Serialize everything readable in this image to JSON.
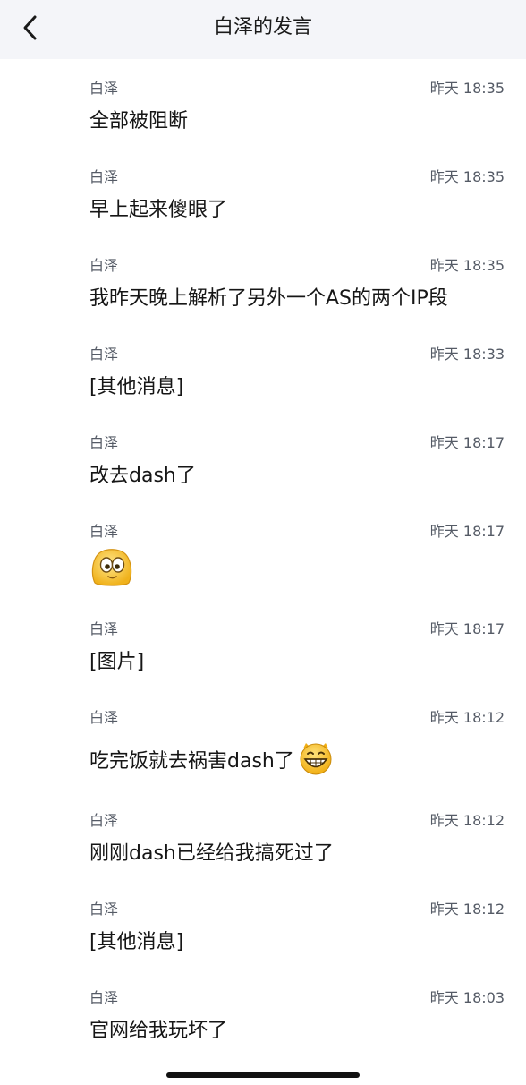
{
  "header": {
    "title": "白泽的发言",
    "back_icon": "chevron-left-icon"
  },
  "messages": [
    {
      "sender": "白泽",
      "time": "昨天 18:35",
      "text": "全部被阻断"
    },
    {
      "sender": "白泽",
      "time": "昨天 18:35",
      "text": "早上起来傻眼了"
    },
    {
      "sender": "白泽",
      "time": "昨天 18:35",
      "text": "我昨天晚上解析了另外一个AS的两个IP段"
    },
    {
      "sender": "白泽",
      "time": "昨天 18:33",
      "text": "[其他消息]"
    },
    {
      "sender": "白泽",
      "time": "昨天 18:17",
      "text": "改去dash了"
    },
    {
      "sender": "白泽",
      "time": "昨天 18:17",
      "text": "",
      "sticker": "wide-eyed-emoji-icon"
    },
    {
      "sender": "白泽",
      "time": "昨天 18:17",
      "text": "[图片]"
    },
    {
      "sender": "白泽",
      "time": "昨天 18:12",
      "text": "吃完饭就去祸害dash了",
      "emoji": "grinning-emoji-icon"
    },
    {
      "sender": "白泽",
      "time": "昨天 18:12",
      "text": "刚刚dash已经给我搞死过了"
    },
    {
      "sender": "白泽",
      "time": "昨天 18:12",
      "text": "[其他消息]"
    },
    {
      "sender": "白泽",
      "time": "昨天 18:03",
      "text": "官网给我玩坏了"
    }
  ],
  "colors": {
    "nav_background": "#f4f5f9",
    "meta_text": "#555b66",
    "body_text": "#161616"
  }
}
